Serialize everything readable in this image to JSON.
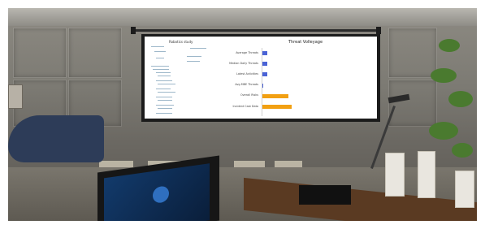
{
  "projection": {
    "chart_title": "Threat Volleyage",
    "categories": [
      "Average Threats",
      "Median Daily Threats",
      "Latest Activities",
      "Avg MBE Threats",
      "Overall Risks",
      "Incident Cast Data"
    ],
    "values": [
      4,
      4,
      4,
      1,
      22,
      25
    ],
    "bar_colors": [
      "#4a63d6",
      "#4a63d6",
      "#4a63d6",
      "#4a63d6",
      "#f2a012",
      "#f2a012"
    ],
    "doc_title": "Robotics study"
  },
  "chart_data": {
    "type": "bar",
    "title": "Threat Volleyage",
    "categories": [
      "Average Threats",
      "Median Daily Threats",
      "Latest Activities",
      "Avg MBE Threats",
      "Overall Risks",
      "Incident Cast Data"
    ],
    "values": [
      4,
      4,
      4,
      1,
      22,
      25
    ],
    "orientation": "horizontal"
  }
}
